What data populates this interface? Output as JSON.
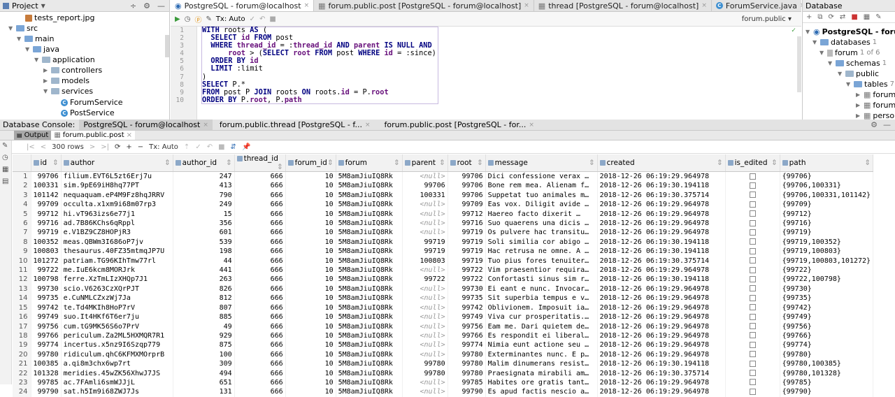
{
  "project": {
    "title": "Project",
    "items": [
      {
        "label": "tests_report.jpg",
        "kind": "image"
      },
      {
        "label": "src",
        "kind": "folder"
      },
      {
        "label": "main",
        "kind": "folder"
      },
      {
        "label": "java",
        "kind": "folder"
      },
      {
        "label": "application",
        "kind": "package"
      },
      {
        "label": "controllers",
        "kind": "package"
      },
      {
        "label": "models",
        "kind": "package"
      },
      {
        "label": "services",
        "kind": "package"
      },
      {
        "label": "ForumService",
        "kind": "class"
      },
      {
        "label": "PostService",
        "kind": "class"
      }
    ]
  },
  "editor": {
    "tabs": [
      "PostgreSQL - forum@localhost",
      "forum.public.post [PostgreSQL - forum@localhost]",
      "thread [PostgreSQL - forum@localhost]",
      "ForumService.java"
    ],
    "tx_label": "Tx: Auto",
    "schema_label": "forum.public",
    "lines": [
      "WITH roots AS (",
      "  SELECT id FROM post",
      "  WHERE thread_id = :thread_id AND parent IS NULL AND",
      "      root > (SELECT root FROM post WHERE id = :since)",
      "  ORDER BY id",
      "  LIMIT :limit",
      ")",
      "SELECT P.*",
      "FROM post P JOIN roots ON roots.id = P.root",
      "ORDER BY P.root, P.path"
    ]
  },
  "database": {
    "title": "Database",
    "items": [
      {
        "label": "PostgreSQL - forum@",
        "count": ""
      },
      {
        "label": "databases",
        "count": "1"
      },
      {
        "label": "forum",
        "count": "1 of 6"
      },
      {
        "label": "schemas",
        "count": "1"
      },
      {
        "label": "public",
        "count": ""
      },
      {
        "label": "tables",
        "count": "7"
      },
      {
        "label": "forum",
        "count": ""
      },
      {
        "label": "forum_",
        "count": ""
      },
      {
        "label": "person",
        "count": ""
      }
    ]
  },
  "console": {
    "label": "Database Console:",
    "tabs": [
      "PostgreSQL - forum@localhost",
      "forum.public.thread [PostgreSQL - f...",
      "forum.public.post [PostgreSQL - for..."
    ],
    "subtabs": [
      "Output",
      "forum.public.post"
    ],
    "rows_label": "300 rows",
    "tx_label": "Tx: Auto",
    "columns": [
      "id",
      "author",
      "author_id",
      "thread_id",
      "forum_id",
      "forum",
      "parent",
      "root",
      "message",
      "created",
      "is_edited",
      "path"
    ],
    "rows": [
      [
        "99706",
        "filium.EVT6L5zt6Erj7u",
        "247",
        "666",
        "10",
        "5M8amJiuIQ8Rk",
        "<null>",
        "99706",
        "Dici confessione verax …",
        "2018-12-26 06:19:29.964978",
        "",
        "{99706}"
      ],
      [
        "100331",
        "sim.9pE69iH8hq77PT",
        "413",
        "666",
        "10",
        "5M8amJiuIQ8Rk",
        "99706",
        "99706",
        "Bone rem mea. Alienam f…",
        "2018-12-26 06:19:30.194118",
        "",
        "{99706,100331}"
      ],
      [
        "101142",
        "nequaquam.eP4M9Fz8hqJRRV",
        "790",
        "666",
        "10",
        "5M8amJiuIQ8Rk",
        "100331",
        "99706",
        "Suppetat tuo animales m…",
        "2018-12-26 06:19:30.375714",
        "",
        "{99706,100331,101142}"
      ],
      [
        "99709",
        "occulta.x1xm9i68m07rp3",
        "249",
        "666",
        "10",
        "5M8amJiuIQ8Rk",
        "<null>",
        "99709",
        "Eas vox. Diligit avide …",
        "2018-12-26 06:19:29.964978",
        "",
        "{99709}"
      ],
      [
        "99712",
        "hi.vT963izs6e77j1",
        "15",
        "666",
        "10",
        "5M8amJiuIQ8Rk",
        "<null>",
        "99712",
        "Haereo facto dixerit …",
        "2018-12-26 06:19:29.964978",
        "",
        "{99712}"
      ],
      [
        "99716",
        "ad.7B86KChs6qRppl",
        "356",
        "666",
        "10",
        "5M8amJiuIQ8Rk",
        "<null>",
        "99716",
        "Suo quaerens una dicis …",
        "2018-12-26 06:19:29.964978",
        "",
        "{99716}"
      ],
      [
        "99719",
        "e.V1BZ9CZ8HOPjR3",
        "601",
        "666",
        "10",
        "5M8amJiuIQ8Rk",
        "<null>",
        "99719",
        "Os pulvere hac transitu…",
        "2018-12-26 06:19:29.964978",
        "",
        "{99719}"
      ],
      [
        "100352",
        "meas.QBWm3I686oP7jv",
        "539",
        "666",
        "10",
        "5M8amJiuIQ8Rk",
        "99719",
        "99719",
        "Soli similia cor abigo …",
        "2018-12-26 06:19:30.194118",
        "",
        "{99719,100352}"
      ],
      [
        "100803",
        "thesaurus.40FZ35mtmqJP7U",
        "198",
        "666",
        "10",
        "5M8amJiuIQ8Rk",
        "99719",
        "99719",
        "Hac retrusa ne omne. A …",
        "2018-12-26 06:19:30.194118",
        "",
        "{99719,100803}"
      ],
      [
        "101272",
        "patriam.TG96KIhTmw77rl",
        "44",
        "666",
        "10",
        "5M8amJiuIQ8Rk",
        "100803",
        "99719",
        "Tuo pius fores tenuiter…",
        "2018-12-26 06:19:30.375714",
        "",
        "{99719,100803,101272}"
      ],
      [
        "99722",
        "me.IuE6kcm8MORJrk",
        "441",
        "666",
        "10",
        "5M8amJiuIQ8Rk",
        "<null>",
        "99722",
        "Vim praesentior requira…",
        "2018-12-26 06:19:29.964978",
        "",
        "{99722}"
      ],
      [
        "100798",
        "ferre.XzTmLIzXHQp7J1",
        "263",
        "666",
        "10",
        "5M8amJiuIQ8Rk",
        "99722",
        "99722",
        "Confortasti sinus sim r…",
        "2018-12-26 06:19:30.194118",
        "",
        "{99722,100798}"
      ],
      [
        "99730",
        "scio.V6263CzXQrPJT",
        "826",
        "666",
        "10",
        "5M8amJiuIQ8Rk",
        "<null>",
        "99730",
        "Ei eant e nunc. Invocar…",
        "2018-12-26 06:19:29.964978",
        "",
        "{99730}"
      ],
      [
        "99735",
        "e.CuNMLCZxzWj7Ja",
        "812",
        "666",
        "10",
        "5M8amJiuIQ8Rk",
        "<null>",
        "99735",
        "Sit superbia tempus e v…",
        "2018-12-26 06:19:29.964978",
        "",
        "{99735}"
      ],
      [
        "99742",
        "te.Td4MKIh8HoP7rV",
        "807",
        "666",
        "10",
        "5M8amJiuIQ8Rk",
        "<null>",
        "99742",
        "Oblivionem. Imposuit ia…",
        "2018-12-26 06:19:29.964978",
        "",
        "{99742}"
      ],
      [
        "99749",
        "suo.It4HKf6T6er7ju",
        "885",
        "666",
        "10",
        "5M8amJiuIQ8Rk",
        "<null>",
        "99749",
        "Viva cur prosperitatis.…",
        "2018-12-26 06:19:29.964978",
        "",
        "{99749}"
      ],
      [
        "99756",
        "cum.tG9MK56S6o7PrV",
        "49",
        "666",
        "10",
        "5M8amJiuIQ8Rk",
        "<null>",
        "99756",
        "Eam me. Dari quietem de…",
        "2018-12-26 06:19:29.964978",
        "",
        "{99756}"
      ],
      [
        "99766",
        "periculum.Za2ML5HXMQR7R1",
        "929",
        "666",
        "10",
        "5M8amJiuIQ8Rk",
        "<null>",
        "99766",
        "Es respondit ei liberal…",
        "2018-12-26 06:19:29.964978",
        "",
        "{99766}"
      ],
      [
        "99774",
        "incertus.x5nz9I6Szqp779",
        "875",
        "666",
        "10",
        "5M8amJiuIQ8Rk",
        "<null>",
        "99774",
        "Nimia eunt actione seu …",
        "2018-12-26 06:19:29.964978",
        "",
        "{99774}"
      ],
      [
        "99780",
        "ridiculum.qhC6KFMXMOrprB",
        "100",
        "666",
        "10",
        "5M8amJiuIQ8Rk",
        "<null>",
        "99780",
        "Exterminantes nunc. E p…",
        "2018-12-26 06:19:29.964978",
        "",
        "{99780}"
      ],
      [
        "100385",
        "a.qi8m3chx6wp7rt",
        "309",
        "666",
        "10",
        "5M8amJiuIQ8Rk",
        "99780",
        "99780",
        "Malim dinumerans resist…",
        "2018-12-26 06:19:30.194118",
        "",
        "{99780,100385}"
      ],
      [
        "101328",
        "meridies.45wZK56XhwJ7JS",
        "494",
        "666",
        "10",
        "5M8amJiuIQ8Rk",
        "99780",
        "99780",
        "Praesignata mirabili am…",
        "2018-12-26 06:19:30.375714",
        "",
        "{99780,101328}"
      ],
      [
        "99785",
        "ac.7FAmli6smWJJjL",
        "651",
        "666",
        "10",
        "5M8amJiuIQ8Rk",
        "<null>",
        "99785",
        "Habites ore gratis tant…",
        "2018-12-26 06:19:29.964978",
        "",
        "{99785}"
      ],
      [
        "99790",
        "sat.h5Im9i68ZWJ7Js",
        "131",
        "666",
        "10",
        "5M8amJiuIQ8Rk",
        "<null>",
        "99790",
        "Es apud factis nescio a…",
        "2018-12-26 06:19:29.964978",
        "",
        "{99790}"
      ]
    ]
  }
}
